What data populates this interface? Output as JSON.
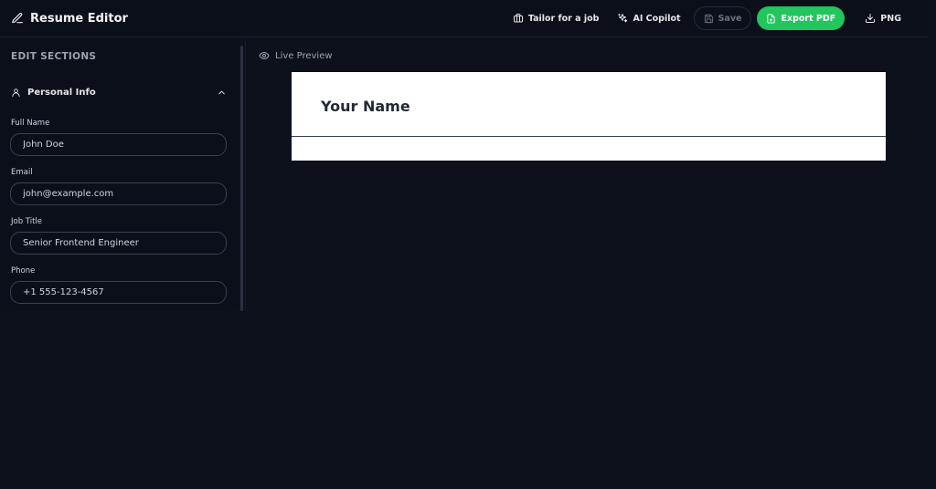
{
  "header": {
    "app_title": "Resume Editor",
    "actions": {
      "tailor": "Tailor for a job",
      "copilot": "AI Copilot",
      "save": "Save",
      "export_pdf": "Export PDF",
      "png": "PNG"
    }
  },
  "sidebar": {
    "section_heading": "EDIT SECTIONS",
    "personal_info": {
      "label": "Personal Info",
      "fields": {
        "full_name": {
          "label": "Full Name",
          "value": "John Doe"
        },
        "email": {
          "label": "Email",
          "value": "john@example.com"
        },
        "job_title": {
          "label": "Job Title",
          "value": "Senior Frontend Engineer"
        },
        "phone": {
          "label": "Phone",
          "value": "+1 555-123-4567"
        }
      }
    }
  },
  "preview": {
    "label": "Live Preview",
    "name": "Your Name"
  },
  "colors": {
    "accent": "#22c55e",
    "background": "#0d111c",
    "panel": "#0b0f19"
  }
}
